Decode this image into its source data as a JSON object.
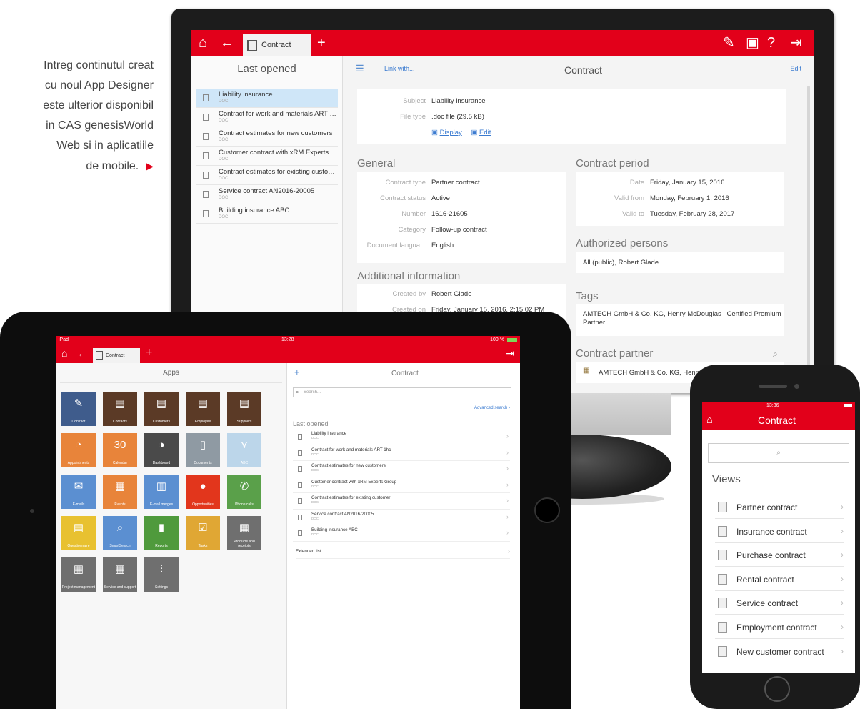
{
  "caption": {
    "line1": "Intreg continutul creat",
    "line2": "cu noul App Designer",
    "line3": "este ulterior disponibil",
    "line4": "in CAS genesisWorld",
    "line5": "Web si in aplicatiile",
    "line6": "de mobile."
  },
  "desktop": {
    "tab_label": "Contract",
    "last_opened_title": "Last opened",
    "list": [
      {
        "title": "Liability insurance",
        "sub": "DOC"
      },
      {
        "title": "Contract for work and materials ART 1hc",
        "sub": "DOC"
      },
      {
        "title": "Contract estimates for new customers",
        "sub": "DOC"
      },
      {
        "title": "Customer contract with xRM Experts Gr...",
        "sub": "DOC"
      },
      {
        "title": "Contract estimates for existing customer",
        "sub": "DOC"
      },
      {
        "title": "Service contract AN2016-20005",
        "sub": "DOC"
      },
      {
        "title": "Building insurance ABC",
        "sub": "DOC"
      }
    ],
    "link_with": "Link with...",
    "detail_title": "Contract",
    "edit": "Edit",
    "subject_label": "Subject",
    "subject_value": "Liability insurance",
    "filetype_label": "File type",
    "filetype_value": ".doc file (29.5 kB)",
    "display_link": "Display",
    "edit_link": "Edit",
    "general_title": "General",
    "general": [
      {
        "label": "Contract type",
        "value": "Partner contract"
      },
      {
        "label": "Contract status",
        "value": "Active"
      },
      {
        "label": "Number",
        "value": "1616-21605"
      },
      {
        "label": "Category",
        "value": "Follow-up contract"
      },
      {
        "label": "Document langua...",
        "value": "English"
      }
    ],
    "additional_title": "Additional information",
    "created_by_label": "Created by",
    "created_by_value": "Robert Glade",
    "created_on_label": "Created on",
    "created_on_value": "Friday, January 15, 2016, 2:15:02 PM",
    "period_title": "Contract period",
    "period": [
      {
        "label": "Date",
        "value": "Friday, January 15, 2016"
      },
      {
        "label": "Valid from",
        "value": "Monday, February 1, 2016"
      },
      {
        "label": "Valid to",
        "value": "Tuesday, February 28, 2017"
      }
    ],
    "authorized_title": "Authorized persons",
    "authorized_value": "All (public), Robert Glade",
    "tags_title": "Tags",
    "tags_value": "AMTECH GmbH & Co. KG, Henry McDouglas  |  Certified Premium Partner",
    "partner_title": "Contract partner",
    "partner_value": "AMTECH GmbH & Co. KG, Henry McDouglas"
  },
  "ipad": {
    "status_left": "iPad",
    "status_time": "13:28",
    "status_right": "100 %",
    "tab_label": "Contract",
    "apps_title": "Apps",
    "apps": [
      {
        "label": "Contract",
        "color": "#3f5c8c",
        "glyph": "✎"
      },
      {
        "label": "Contacts",
        "color": "#5b3a26",
        "glyph": "▤"
      },
      {
        "label": "Customers",
        "color": "#5b3a26",
        "glyph": "▤"
      },
      {
        "label": "Employee",
        "color": "#5b3a26",
        "glyph": "▤"
      },
      {
        "label": "Suppliers",
        "color": "#5b3a26",
        "glyph": "▤"
      },
      {
        "label": "Appointments",
        "color": "#e8843a",
        "glyph": "◔"
      },
      {
        "label": "Calendar",
        "color": "#e8843a",
        "glyph": "30"
      },
      {
        "label": "Dashboard",
        "color": "#4a4a4a",
        "glyph": "◑"
      },
      {
        "label": "Documents",
        "color": "#8f9aa3",
        "glyph": "▯"
      },
      {
        "label": "ABC",
        "color": "#bcd6ea",
        "glyph": "⋎"
      },
      {
        "label": "E-mails",
        "color": "#5b8fd1",
        "glyph": "✉"
      },
      {
        "label": "Events",
        "color": "#e8843a",
        "glyph": "▦"
      },
      {
        "label": "E-mail merges",
        "color": "#5b8fd1",
        "glyph": "▥"
      },
      {
        "label": "Opportunities",
        "color": "#e2361c",
        "glyph": "●"
      },
      {
        "label": "Phone calls",
        "color": "#5aa04a",
        "glyph": "✆"
      },
      {
        "label": "Questionnaire",
        "color": "#e8c130",
        "glyph": "▤"
      },
      {
        "label": "SmartSearch",
        "color": "#5b8fd1",
        "glyph": "⌕"
      },
      {
        "label": "Reports",
        "color": "#4f9a3c",
        "glyph": "▮"
      },
      {
        "label": "Tasks",
        "color": "#e0a734",
        "glyph": "☑"
      },
      {
        "label": "Products and receipts",
        "color": "#6f6f6f",
        "glyph": "▦"
      },
      {
        "label": "Project management",
        "color": "#6f6f6f",
        "glyph": "▦"
      },
      {
        "label": "Service and support",
        "color": "#6f6f6f",
        "glyph": "▦"
      },
      {
        "label": "Settings",
        "color": "#6f6f6f",
        "glyph": "⫶"
      }
    ],
    "detail_title": "Contract",
    "search_placeholder": "Search...",
    "advanced_search": "Advanced search",
    "last_opened": "Last opened",
    "list": [
      {
        "title": "Liability insurance",
        "sub": "DOC"
      },
      {
        "title": "Contract for work and materials ART 1hc",
        "sub": "DOC"
      },
      {
        "title": "Contract estimates for new customers",
        "sub": "DOC"
      },
      {
        "title": "Customer contract with xRM Experts Group",
        "sub": "DOC"
      },
      {
        "title": "Contract estimates for existing customer",
        "sub": "DOC"
      },
      {
        "title": "Service contract AN2016-20005",
        "sub": "DOC"
      },
      {
        "title": "Building insurance ABC",
        "sub": "DOC"
      }
    ],
    "extended_list": "Extended list"
  },
  "phone": {
    "time": "13:36",
    "title": "Contract",
    "views_title": "Views",
    "views": [
      "Partner contract",
      "Insurance contract",
      "Purchase contract",
      "Rental contract",
      "Service contract",
      "Employment contract",
      "New customer contract"
    ]
  }
}
